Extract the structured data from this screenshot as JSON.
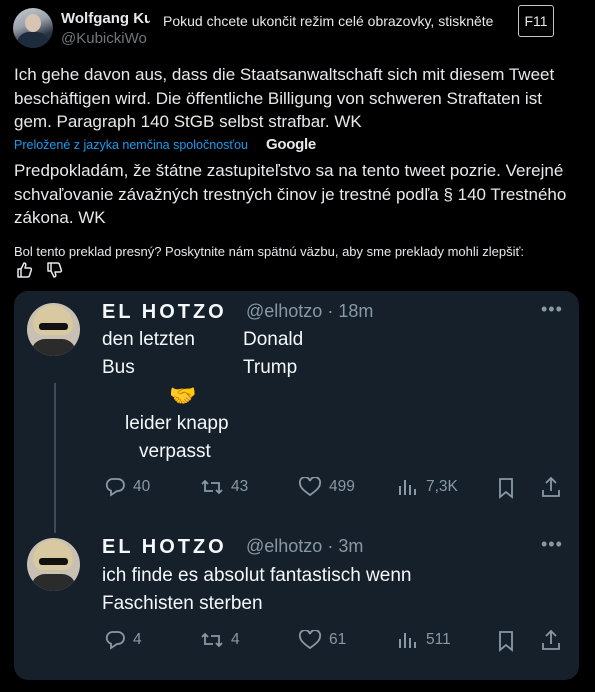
{
  "header": {
    "author_name": "Wolfgang Kubicki",
    "author_handle": "@KubickiWo"
  },
  "fullscreen_notice": {
    "message": "Pokud chcete ukončit režim celé obrazovky, stiskněte",
    "key": "F11"
  },
  "tweet": {
    "text": "Ich gehe davon aus, dass die Staatsanwaltschaft sich mit diesem Tweet beschäftigen wird. Die öffentliche Billigung von schweren Straftaten ist gem. Paragraph 140 StGB selbst strafbar. WK",
    "translated_label": "Preložené z jazyka nemčina spoločnosťou",
    "translator": "Google",
    "translation": "Predpokladám, že štátne zastupiteľstvo sa na tento tweet pozrie. Verejné schvaľovanie závažných trestných činov je trestné podľa § 140 Trestného zákona. WK",
    "feedback_prompt": "Bol tento preklad presný? Poskytnite nám spätnú väzbu, aby sme preklady mohli zlepšiť:"
  },
  "embedded": {
    "tweet1": {
      "name": "EL HOTZO",
      "handle": "@elhotzo",
      "time": "18m",
      "left_line1": "den letzten",
      "left_line2": "Bus",
      "right_line1": "Donald",
      "right_line2": "Trump",
      "emoji": "🤝",
      "center_line1": "leider knapp",
      "center_line2": "verpasst",
      "replies": "40",
      "retweets": "43",
      "likes": "499",
      "views": "7,3K"
    },
    "tweet2": {
      "name": "EL HOTZO",
      "handle": "@elhotzo",
      "time": "3m",
      "line1": "ich finde es absolut fantastisch wenn",
      "line2": "Faschisten sterben",
      "replies": "4",
      "retweets": "4",
      "likes": "61",
      "views": "511"
    }
  },
  "colors": {
    "background": "#000000",
    "link_blue": "#1d9bf0",
    "embed_bg": "#15202b",
    "muted": "#8899a6"
  }
}
